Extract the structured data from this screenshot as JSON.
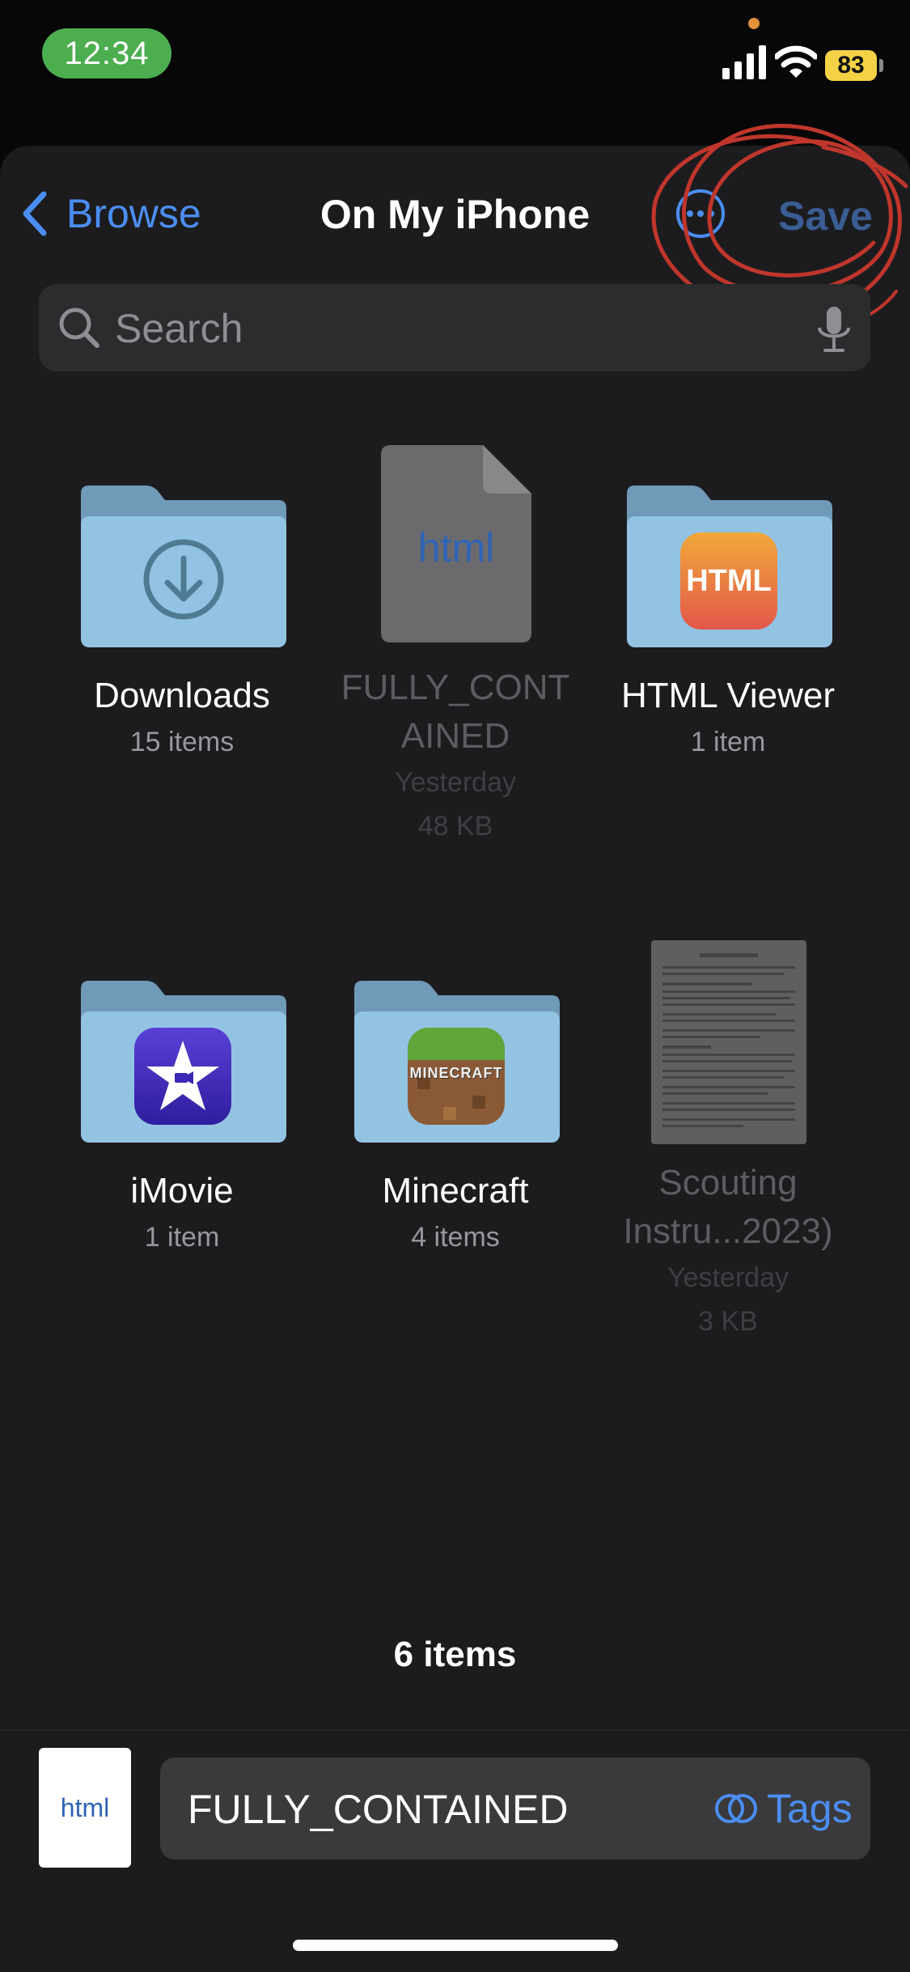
{
  "status_bar": {
    "time": "12:34",
    "battery": "83",
    "colors": {
      "time_pill": "#4cae4f",
      "battery": "#f4d245"
    }
  },
  "nav": {
    "back_label": "Browse",
    "title": "On My iPhone",
    "save_label": "Save"
  },
  "search": {
    "placeholder": "Search"
  },
  "items": [
    {
      "name": "Downloads",
      "subtitle": "15 items",
      "type": "folder",
      "icon": "download-arrow-icon"
    },
    {
      "name": "FULLY_CONTAINED",
      "display_name_lines": [
        "FULLY_CONT",
        "AINED"
      ],
      "date": "Yesterday",
      "size": "48 KB",
      "type": "file",
      "file_label": "html"
    },
    {
      "name": "HTML Viewer",
      "subtitle": "1 item",
      "type": "folder",
      "badge_text": "HTML"
    },
    {
      "name": "iMovie",
      "subtitle": "1 item",
      "type": "folder",
      "icon": "imovie-star-icon"
    },
    {
      "name": "Minecraft",
      "subtitle": "4 items",
      "type": "folder",
      "badge_text": "MINECRAFT"
    },
    {
      "name": "Scouting Instru...2023)",
      "display_name_lines": [
        "Scouting",
        "Instru...2023)"
      ],
      "date": "Yesterday",
      "size": "3 KB",
      "type": "document"
    }
  ],
  "footer": {
    "count": "6 items"
  },
  "bottom": {
    "file_label": "html",
    "filename": "FULLY_CONTAINED",
    "tags_label": "Tags"
  },
  "colors": {
    "accent": "#4b8ef2",
    "annotation": "#c0362c"
  }
}
